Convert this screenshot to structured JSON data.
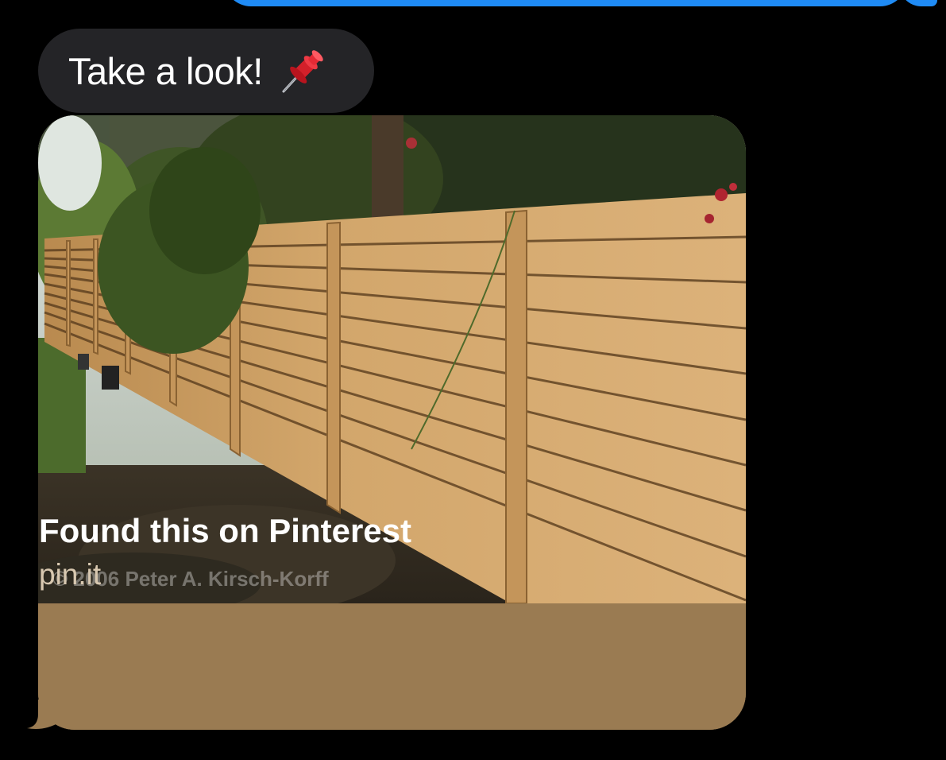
{
  "conversation": {
    "incoming_message": {
      "text": "Take a look!",
      "emoji_icon": "pushpin-icon"
    },
    "link_preview": {
      "title": "Found this on Pinterest",
      "domain": "pin.it",
      "image_caption_watermark": "© 2006 Peter A. Kirsch-Korff",
      "image_subject": "horizontal-wood-fence-photo"
    }
  },
  "colors": {
    "background": "#000000",
    "incoming_bubble": "#242427",
    "outgoing_bubble": "#1f8bf5",
    "card_footer": "#9a7b52",
    "card_domain_text": "#d8c8b0"
  }
}
